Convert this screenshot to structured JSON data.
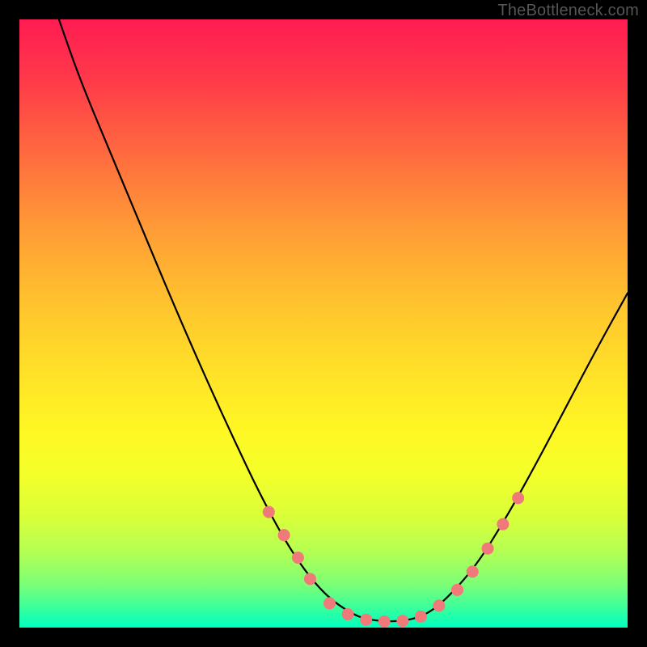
{
  "watermark": "TheBottleneck.com",
  "chart_data": {
    "type": "line",
    "title": "",
    "xlabel": "",
    "ylabel": "",
    "xlim": [
      0,
      100
    ],
    "ylim": [
      0,
      100
    ],
    "gradient_stops": [
      {
        "pct": 0,
        "color": "#ff1c52"
      },
      {
        "pct": 10,
        "color": "#ff3a49"
      },
      {
        "pct": 22,
        "color": "#ff6a3f"
      },
      {
        "pct": 34,
        "color": "#ff9a36"
      },
      {
        "pct": 46,
        "color": "#ffc12e"
      },
      {
        "pct": 58,
        "color": "#ffe128"
      },
      {
        "pct": 68,
        "color": "#fff824"
      },
      {
        "pct": 75,
        "color": "#f3ff2a"
      },
      {
        "pct": 82,
        "color": "#d8ff3a"
      },
      {
        "pct": 88,
        "color": "#b0ff55"
      },
      {
        "pct": 93,
        "color": "#7aff78"
      },
      {
        "pct": 97,
        "color": "#35ff9e"
      },
      {
        "pct": 100,
        "color": "#00ffc0"
      }
    ],
    "series": [
      {
        "name": "curve",
        "color": "#000000",
        "points": [
          {
            "x": 6.5,
            "y": 100.0
          },
          {
            "x": 10.0,
            "y": 90.0
          },
          {
            "x": 15.0,
            "y": 78.0
          },
          {
            "x": 20.0,
            "y": 66.0
          },
          {
            "x": 25.0,
            "y": 54.0
          },
          {
            "x": 30.0,
            "y": 42.5
          },
          {
            "x": 35.0,
            "y": 31.5
          },
          {
            "x": 40.0,
            "y": 21.0
          },
          {
            "x": 45.0,
            "y": 12.0
          },
          {
            "x": 50.0,
            "y": 5.5
          },
          {
            "x": 55.0,
            "y": 2.0
          },
          {
            "x": 58.0,
            "y": 1.2
          },
          {
            "x": 61.0,
            "y": 1.0
          },
          {
            "x": 64.0,
            "y": 1.2
          },
          {
            "x": 67.0,
            "y": 2.2
          },
          {
            "x": 70.0,
            "y": 4.5
          },
          {
            "x": 75.0,
            "y": 10.0
          },
          {
            "x": 80.0,
            "y": 18.0
          },
          {
            "x": 85.0,
            "y": 27.0
          },
          {
            "x": 90.0,
            "y": 36.5
          },
          {
            "x": 95.0,
            "y": 46.0
          },
          {
            "x": 100.0,
            "y": 55.0
          }
        ]
      }
    ],
    "scatter": {
      "name": "dots",
      "color": "#f07a7a",
      "radius_pct": 1.0,
      "points": [
        {
          "x": 41.0,
          "y": 19.0
        },
        {
          "x": 43.5,
          "y": 15.2
        },
        {
          "x": 45.8,
          "y": 11.5
        },
        {
          "x": 47.8,
          "y": 8.0
        },
        {
          "x": 51.0,
          "y": 4.0
        },
        {
          "x": 54.0,
          "y": 2.2
        },
        {
          "x": 57.0,
          "y": 1.3
        },
        {
          "x": 60.0,
          "y": 1.0
        },
        {
          "x": 63.0,
          "y": 1.1
        },
        {
          "x": 66.0,
          "y": 1.8
        },
        {
          "x": 69.0,
          "y": 3.6
        },
        {
          "x": 72.0,
          "y": 6.2
        },
        {
          "x": 74.5,
          "y": 9.2
        },
        {
          "x": 77.0,
          "y": 13.0
        },
        {
          "x": 79.5,
          "y": 17.0
        },
        {
          "x": 82.0,
          "y": 21.3
        }
      ]
    }
  }
}
